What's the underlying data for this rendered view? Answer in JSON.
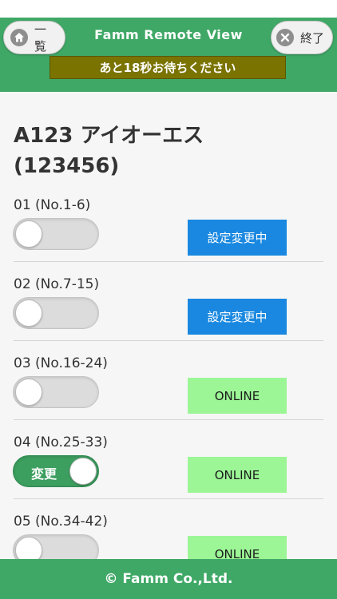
{
  "header": {
    "title": "Famm Remote View",
    "list_button_label": "一覧",
    "end_button_label": "終了",
    "wait_message": "あと18秒お待ちください",
    "background_color": "#3fa866",
    "wait_bar_color": "#7a7300"
  },
  "device": {
    "name": "A123 アイオーエス",
    "id_line": "(123456)"
  },
  "rows": [
    {
      "label": "01 (No.1-6)",
      "toggle_on": false,
      "toggle_text": "",
      "status": "設定変更中",
      "status_type": "changing"
    },
    {
      "label": "02 (No.7-15)",
      "toggle_on": false,
      "toggle_text": "",
      "status": "設定変更中",
      "status_type": "changing"
    },
    {
      "label": "03 (No.16-24)",
      "toggle_on": false,
      "toggle_text": "",
      "status": "ONLINE",
      "status_type": "online"
    },
    {
      "label": "04 (No.25-33)",
      "toggle_on": true,
      "toggle_text": "変更",
      "status": "ONLINE",
      "status_type": "online"
    },
    {
      "label": "05 (No.34-42)",
      "toggle_on": false,
      "toggle_text": "",
      "status": "ONLINE",
      "status_type": "online"
    }
  ],
  "status_colors": {
    "changing": "#1a88e0",
    "online": "#9cf696"
  },
  "footer": {
    "text": "© Famm Co.,Ltd."
  }
}
